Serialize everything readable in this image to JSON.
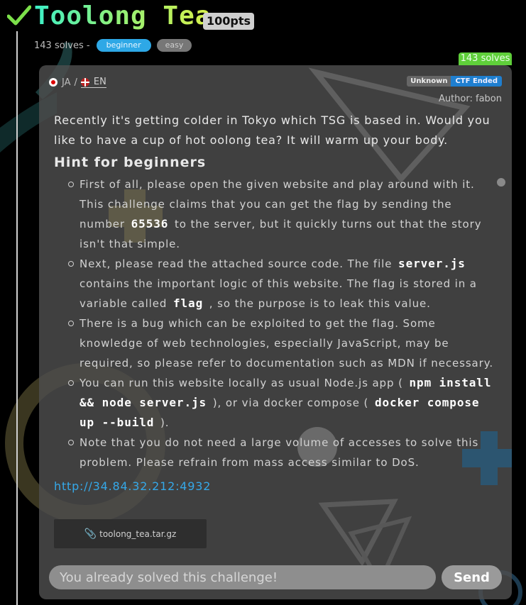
{
  "challenge": {
    "title": "Toolong Tea",
    "points": "100pts",
    "solves_text": "143 solves -",
    "tags": [
      "beginner",
      "easy"
    ],
    "solves_badge": "143 solves"
  },
  "card": {
    "lang_ja": "JA",
    "lang_sep": "/",
    "lang_en": "EN",
    "status_unknown": "Unknown",
    "status_ctf": "CTF Ended",
    "author": "Author: fabon",
    "description": "Recently it's getting colder in Tokyo which TSG is based in. Would you like to have a cup of hot oolong tea? It will warm up your body.",
    "hint_title": "Hint for beginners",
    "hints": [
      {
        "a": "First of all, please open the given website and play around with it. This challenge claims that you can get the flag by sending the number",
        "code1": "65536",
        "b": "to the server, but it quickly turns out that the story isn't that simple."
      },
      {
        "a": "Next, please read the attached source code. The file",
        "code1": "server.js",
        "b": "contains the important logic of this website. The flag is stored in a variable called",
        "code2": "flag",
        "c": ", so the purpose is to leak this value."
      },
      {
        "a": "There is a bug which can be exploited to get the flag. Some knowledge of web technologies, especially JavaScript, may be required, so please refer to documentation such as MDN if necessary."
      },
      {
        "a": "You can run this website locally as usual Node.js app (",
        "code1": "npm install && node server.js",
        "b": "), or via docker compose (",
        "code2": "docker compose up --build",
        "c": ")."
      },
      {
        "a": "Note that you do not need a large volume of accesses to solve this problem. Please refrain from mass access similar to DoS."
      }
    ],
    "url": "http://34.84.32.212:4932",
    "attachment": "toolong_tea.tar.gz",
    "input_placeholder": "You already solved this challenge!",
    "send_label": "Send"
  }
}
